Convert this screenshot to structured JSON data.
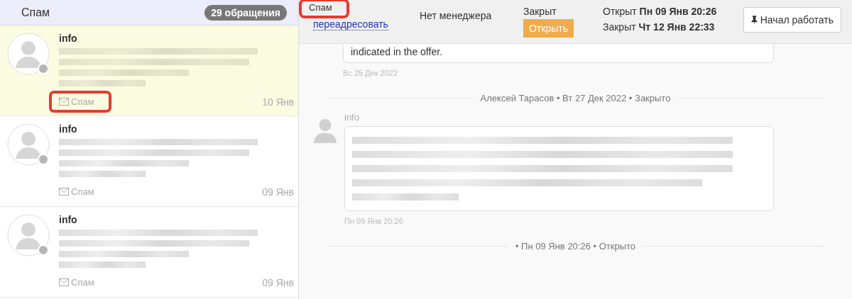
{
  "sidebar": {
    "title": "Спам",
    "count_badge": "29 обращения",
    "items": [
      {
        "name": "info",
        "folder": "Спам",
        "date": "10 Янв",
        "selected": true,
        "highlighted": true
      },
      {
        "name": "info",
        "folder": "Спам",
        "date": "09 Янв",
        "selected": false,
        "highlighted": false
      },
      {
        "name": "info",
        "folder": "Спам",
        "date": "09 Янв",
        "selected": false,
        "highlighted": false
      }
    ]
  },
  "ticket_header": {
    "folder": "Спам",
    "folder_highlighted": true,
    "forward_link": "переадресовать",
    "manager": "Нет менеджера",
    "status": "Закрыт",
    "open_button": "Открыть",
    "opened_label": "Открыт",
    "opened_at": "Пн 09 Янв 20:26",
    "closed_label": "Закрыт",
    "closed_at": "Чт 12 Янв 22:33",
    "start_button": "Начал работать"
  },
  "timeline": [
    {
      "kind": "message",
      "text": "indicated in the offer.",
      "time": "Вс 25 Дек 2022"
    },
    {
      "kind": "divider",
      "text": "Алексей Тарасов • Вт 27 Дек 2022 • Закрыто"
    },
    {
      "kind": "message",
      "author": "info",
      "time": "Пн 09 Янв 20:26"
    },
    {
      "kind": "divider",
      "text": "• Пн 09 Янв 20:26 • Открыто"
    }
  ]
}
